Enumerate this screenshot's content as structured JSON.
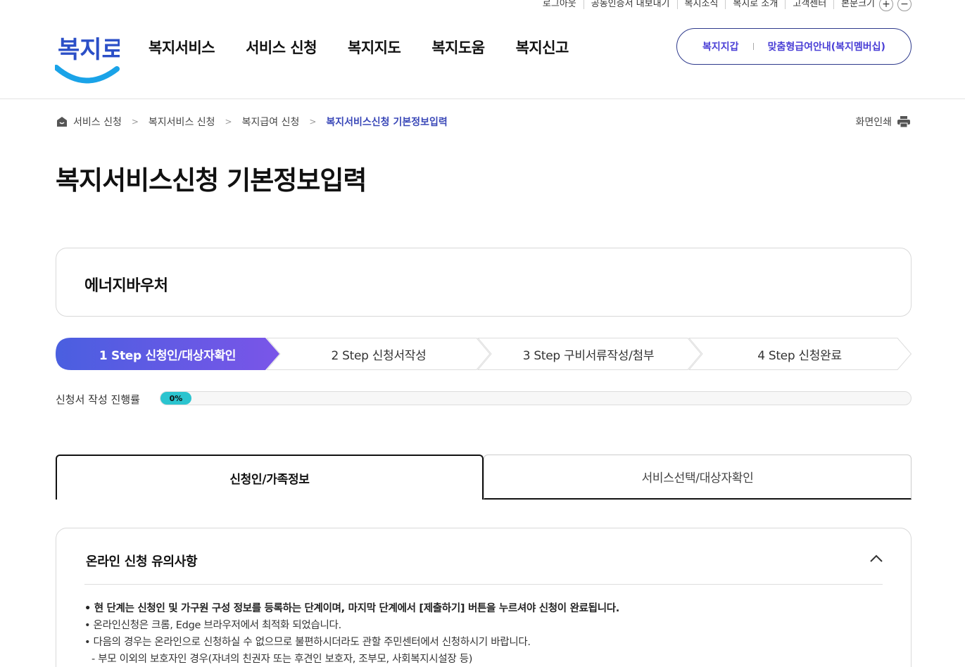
{
  "utility": {
    "items": [
      "로그아웃",
      "공동인증서 내보내기",
      "복지소식",
      "복지로 소개",
      "고객센터",
      "본문크기"
    ],
    "font_plus": "+",
    "font_minus": "−"
  },
  "logo": {
    "text": "복지로"
  },
  "gnb": {
    "items": [
      "복지서비스",
      "서비스 신청",
      "복지지도",
      "복지도움",
      "복지신고"
    ]
  },
  "quick": {
    "wallet": "복지지갑",
    "membership": "맞춤형급여안내(복지멤버십)"
  },
  "breadcrumb": {
    "items": [
      "서비스 신청",
      "복지서비스 신청",
      "복지급여 신청"
    ],
    "current": "복지서비스신청 기본정보입력"
  },
  "print": {
    "label": "화면인쇄"
  },
  "page": {
    "title": "복지서비스신청 기본정보입력"
  },
  "service": {
    "name": "에너지바우처"
  },
  "steps": {
    "items": [
      "1 Step 신청인/대상자확인",
      "2 Step 신청서작성",
      "3 Step 구비서류작성/첨부",
      "4 Step 신청완료"
    ],
    "active_index": 0,
    "active_gradient": [
      "#4a5fe0",
      "#7a55e8"
    ]
  },
  "progress": {
    "label": "신청서 작성 진행률",
    "value_text": "0%",
    "percent": 0
  },
  "tabs": {
    "items": [
      "신청인/가족정보",
      "서비스선택/대상자확인"
    ],
    "active_index": 0
  },
  "notice": {
    "title": "온라인 신청 유의사항",
    "lines": [
      "• 현 단계는 신청인 및 가구원 구성 정보를 등록하는 단계이며, 마지막 단계에서 [제출하기] 버튼을 누르셔야 신청이 완료됩니다.",
      "• 온라인신청은 크롬, Edge 브라우저에서 최적화 되었습니다.",
      "• 다음의 경우는 온라인으로 신청하실 수 없으므로 불편하시더라도 관할 주민센터에서 신청하시기 바랍니다.",
      "- 부모 이외의 보호자인 경우(자녀의 친권자 또는 후견인 보호자, 조부모, 사회복지시설장 등)"
    ]
  },
  "colors": {
    "accent": "#3a48b8",
    "progress": "#2bc4cf",
    "logo_blue": "#1aa3e8",
    "logo_text": "#2b4fc7"
  },
  "icons": [
    "home-icon",
    "chevron-right-icon",
    "print-icon",
    "chevron-up-icon"
  ]
}
